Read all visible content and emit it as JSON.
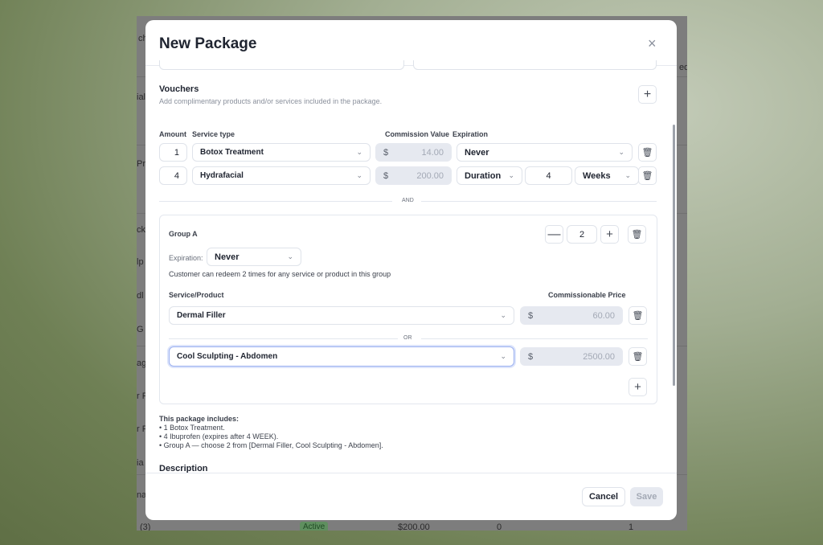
{
  "background_app": {
    "fragments": [
      "ch",
      "ial",
      "Pro",
      "ck",
      "lp",
      "dl",
      "G",
      "ag",
      "r F",
      "r F",
      "ia",
      "na",
      "ed"
    ],
    "last_row": {
      "name": "(3)",
      "status": "Active",
      "price": "$200.00",
      "sold": "0",
      "count": "1"
    }
  },
  "modal": {
    "title": "New Package",
    "close_icon": "×",
    "vouchers": {
      "title": "Vouchers",
      "subtitle": "Add complimentary products and/or services included in the package.",
      "add": "+"
    },
    "columns": {
      "amount": "Amount",
      "service_type": "Service type",
      "commission_value": "Commission Value",
      "expiration": "Expiration"
    },
    "rows": [
      {
        "amount": "1",
        "service": "Botox Treatment",
        "currency": "$",
        "value": "14.00",
        "expiration": "Never"
      },
      {
        "amount": "4",
        "service": "Hydrafacial",
        "currency": "$",
        "value": "200.00",
        "expiration": "Duration",
        "duration": "4",
        "unit": "Weeks"
      }
    ],
    "and_label": "AND",
    "group": {
      "name": "Group A",
      "count": "2",
      "minus": "—",
      "plus": "+",
      "expiration_label": "Expiration:",
      "expiration": "Never",
      "note": "Customer can redeem 2 times for any service or product in this group",
      "col_service": "Service/Product",
      "col_price": "Commissionable Price",
      "items": [
        {
          "name": "Dermal Filler",
          "currency": "$",
          "price": "60.00"
        },
        {
          "name": "Cool Sculpting - Abdomen",
          "currency": "$",
          "price": "2500.00"
        }
      ],
      "or_label": "OR",
      "add": "+"
    },
    "summary": {
      "title": "This package includes:",
      "lines": [
        "• 1 Botox Treatment.",
        "• 4 Ibuprofen (expires after 4 WEEK).",
        "• Group A — choose 2 from [Dermal Filler, Cool Sculpting - Abdomen]."
      ]
    },
    "description_label": "Description",
    "cancel": "Cancel",
    "save": "Save"
  },
  "chevron": "⌄",
  "trash": "🗑"
}
